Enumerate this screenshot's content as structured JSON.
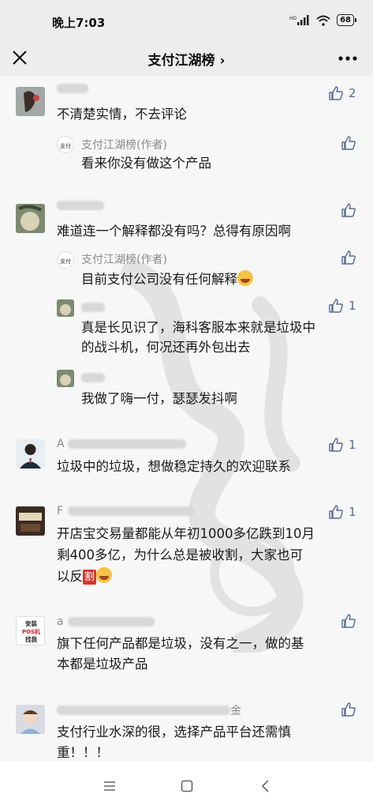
{
  "status": {
    "time": "晚上7:03",
    "battery": "68",
    "network": "HD"
  },
  "nav": {
    "title": "支付江湖榜 ›"
  },
  "comments": [
    {
      "text": "不清楚实情，不去评论",
      "likes": "2"
    },
    {
      "author": "支付江湖榜(作者)",
      "text": "看来你没有做这个产品"
    },
    {
      "text": "难道连一个解释都没有吗？总得有原因啊"
    },
    {
      "author": "支付江湖榜(作者)",
      "text": "目前支付公司没有任何解释"
    },
    {
      "line1": "真是长见识了，海科客服本来就是垃圾中",
      "line2": "的战斗机，何况还再外包出去",
      "likes": "1"
    },
    {
      "text": "我做了嗨一付，瑟瑟发抖啊"
    },
    {
      "name": "A",
      "text": "垃圾中的垃圾，想做稳定持久的欢迎联系",
      "likes": "1"
    },
    {
      "name": "F",
      "line1": "开店宝交易量都能从年初1000多亿跌到10月",
      "line2": "剩400多亿，为什么总是被收割，大家也可",
      "line3": "以反",
      "ge": "割",
      "likes": "1"
    },
    {
      "name": "a",
      "avatar": [
        "安装",
        "POS机",
        "找我"
      ],
      "line1": "旗下任何产品都是垃圾，没有之一，做的基",
      "line2": "本都是垃圾产品"
    },
    {
      "name_tail": "金",
      "line1": "支付行业水深的很，选择产品平台还需慎",
      "line2": "重！！！"
    }
  ]
}
